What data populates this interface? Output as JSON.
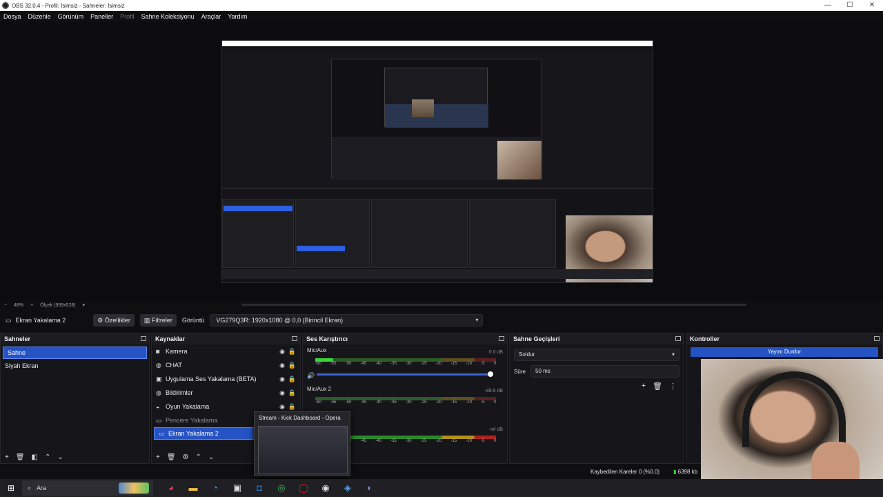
{
  "window": {
    "title": "OBS 32.0.4 - Profil: İsimsiz - Sahneler: İsimsiz"
  },
  "menu": [
    "Dosya",
    "Düzenle",
    "Görünüm",
    "Paneller",
    "Profil",
    "Sahne Koleksiyonu",
    "Araçlar",
    "Yardım"
  ],
  "zoom": {
    "minus": "−",
    "value": "48%",
    "plus": "+",
    "scale": "Ölçek (939x528)"
  },
  "source_toolbar": {
    "selected_source": "Ekran Yakalama 2",
    "properties": "Özellikler",
    "filters": "Filtreler",
    "display_label": "Görüntü",
    "display_value": "VG279Q3R: 1920x1080 @ 0,0 (Birincil Ekran)"
  },
  "scenes": {
    "title": "Sahneler",
    "items": [
      "Sahne",
      "Siyah Ekran"
    ]
  },
  "sources": {
    "title": "Kaynaklar",
    "items": [
      {
        "label": "Kamera",
        "icon": "camera-icon"
      },
      {
        "label": "CHAT",
        "icon": "globe-icon"
      },
      {
        "label": "Uygulama Ses Yakalama (BETA)",
        "icon": "app-audio-icon"
      },
      {
        "label": "Bildirimler",
        "icon": "globe-icon"
      },
      {
        "label": "Oyun Yakalama",
        "icon": "gamepad-icon"
      },
      {
        "label": "Pencere Yakalama",
        "icon": "window-icon"
      },
      {
        "label": "Ekran Yakalama 2",
        "icon": "monitor-icon"
      }
    ]
  },
  "mixer": {
    "title": "Ses Karıştırıcı",
    "channels": [
      {
        "name": "Mic/Aux",
        "db": "0.0 dB"
      },
      {
        "name": "Mic/Aux 2",
        "db": "-88.6 dB"
      },
      {
        "name": "",
        "db": "-inf dB"
      }
    ],
    "ticks": [
      "-60",
      "-55",
      "-50",
      "-45",
      "-40",
      "-35",
      "-30",
      "-25",
      "-20",
      "-15",
      "-10",
      "-5",
      "0"
    ]
  },
  "transitions": {
    "title": "Sahne Geçişleri",
    "selected": "Soldur",
    "duration_label": "Süre",
    "duration_value": "50 ms"
  },
  "controls": {
    "title": "Kontroller",
    "stop_stream": "Yayını Durdur"
  },
  "popup": {
    "title": "Stream - Kick Dashboard - Opera"
  },
  "status": {
    "dropped_frames": "Kaybedilen Kareler 0 (%0.0)",
    "bitrate": "6398 kb"
  },
  "taskbar": {
    "search_placeholder": "Ara"
  },
  "colors": {
    "accent": "#2553c4",
    "meter_green": "#3ad43a",
    "background": "#16161a"
  }
}
